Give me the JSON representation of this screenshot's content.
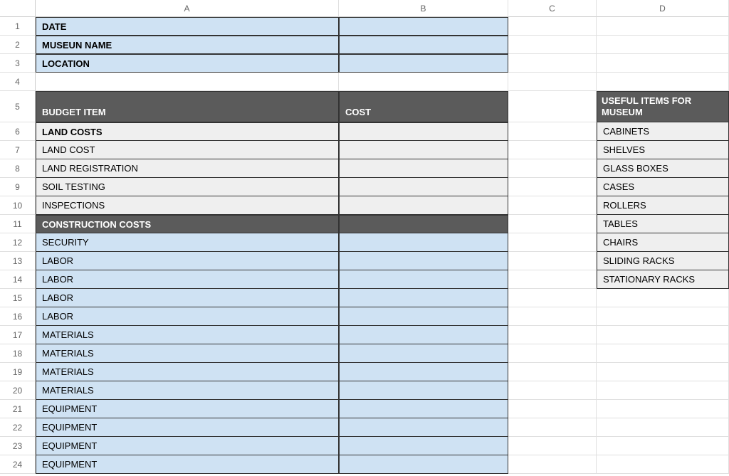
{
  "columns": [
    "A",
    "B",
    "C",
    "D"
  ],
  "header_fields": {
    "date": "DATE",
    "museum_name": "MUSEUN NAME",
    "location": "LOCATION"
  },
  "table_headers": {
    "budget_item": "BUDGET ITEM",
    "cost": "COST",
    "useful_items": "USEFUL ITEMS FOR MUSEUM"
  },
  "sections": {
    "land_costs": "LAND COSTS",
    "construction_costs": "CONSTRUCTION COSTS"
  },
  "land_items": [
    "LAND COST",
    "LAND REGISTRATION",
    "SOIL TESTING",
    "INSPECTIONS"
  ],
  "construction_items": [
    "SECURITY",
    "LABOR",
    "LABOR",
    "LABOR",
    "LABOR",
    "MATERIALS",
    "MATERIALS",
    "MATERIALS",
    "MATERIALS",
    "EQUIPMENT",
    "EQUIPMENT",
    "EQUIPMENT",
    "EQUIPMENT"
  ],
  "useful_items_list": [
    "CABINETS",
    "SHELVES",
    "GLASS BOXES",
    "CASES",
    "ROLLERS",
    "TABLES",
    "CHAIRS",
    "SLIDING RACKS",
    "STATIONARY RACKS"
  ],
  "row_numbers": [
    "1",
    "2",
    "3",
    "4",
    "5",
    "6",
    "7",
    "8",
    "9",
    "10",
    "11",
    "12",
    "13",
    "14",
    "15",
    "16",
    "17",
    "18",
    "19",
    "20",
    "21",
    "22",
    "23",
    "24"
  ]
}
